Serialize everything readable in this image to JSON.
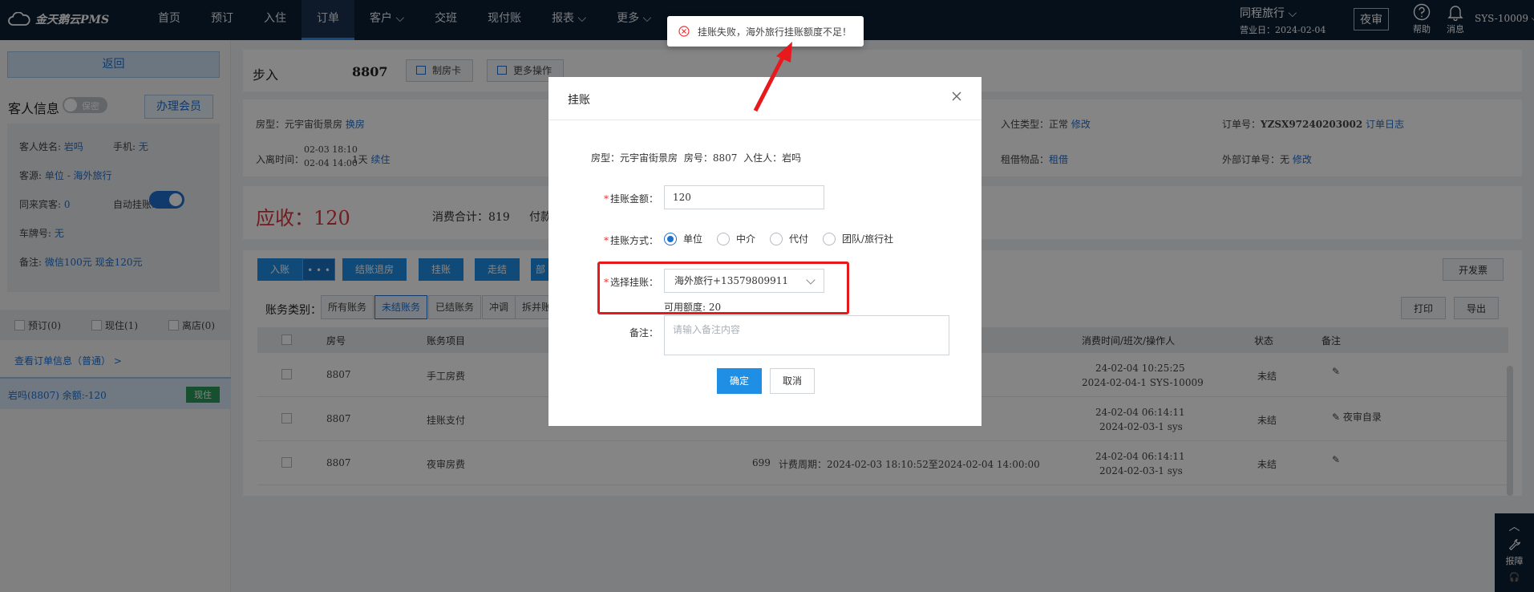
{
  "app": {
    "logo": "金天鹅云PMS"
  },
  "nav": [
    {
      "label": "首页"
    },
    {
      "label": "预订"
    },
    {
      "label": "入住"
    },
    {
      "label": "订单",
      "active": true
    },
    {
      "label": "客户 ⌵"
    },
    {
      "label": "交班"
    },
    {
      "label": "现付账"
    },
    {
      "label": "报表 ⌵"
    },
    {
      "label": "更多 ⌵"
    }
  ],
  "topright": {
    "hotel": "同程旅行 ⌵",
    "business_day": "营业日：2024-02-04",
    "night_audit": "夜审",
    "help": "帮助",
    "messages": "消息",
    "user": "SYS-10009 ⌵"
  },
  "left": {
    "back": "返回",
    "guest_title": "客人信息",
    "secret_toggle": "保密",
    "member_btn": "办理会员",
    "name_label": "客人姓名:",
    "name_value": "岩吗",
    "phone_label": "手机:",
    "phone_value": "无",
    "source_label": "客源:",
    "source_value": "单位 - 海外旅行",
    "companions_label": "同来宾客:",
    "companions_value": "0",
    "auto_bill_label": "自动挂账:",
    "plate_label": "车牌号:",
    "plate_value": "无",
    "remark_label": "备注:",
    "remark_value": "微信100元 现金120元",
    "status": [
      {
        "label": "预订(0)"
      },
      {
        "label": "现住(1)"
      },
      {
        "label": "离店(0)"
      }
    ],
    "order_link": "查看订单信息（普通） >",
    "guest_row": "岩吗(8807)   余额:-120",
    "guest_badge": "现住"
  },
  "header": {
    "state": "步入",
    "room": "8807",
    "btn_card": "制房卡",
    "btn_more": "更多操作"
  },
  "info": {
    "room_type_label": "房型：",
    "room_type": "元宇宙街景房",
    "change": "换房",
    "in_out_label": "入离时间：",
    "in_time": "02-03 18:10",
    "out_time": "02-04 14:00",
    "nights": "1天",
    "extend": "续住",
    "checkin_type_label": "入住类型：",
    "checkin_type": "正常",
    "checkin_modify": "修改",
    "borrow_label": "租借物品：",
    "borrow": "租借",
    "order_no_label": "订单号：",
    "order_no": "YZSX97240203002",
    "order_log": "订单日志",
    "ext_order_label": "外部订单号：",
    "ext_order": "无",
    "ext_modify": "修改"
  },
  "money": {
    "due": "应收：120",
    "consume": "消费合计：819",
    "paid": "付款"
  },
  "bill": {
    "btn_in": "入账",
    "btn_dots": "• • •",
    "btn_checkout_refund": "结账退房",
    "btn_hang": "挂账",
    "btn_walk": "走结",
    "btn_part": "部",
    "btn_invoice": "开发票",
    "btn_print": "打印",
    "btn_export": "导出",
    "cat_label": "账务类别：",
    "cats": [
      {
        "label": "所有账务"
      },
      {
        "label": "未结账务",
        "active": true
      },
      {
        "label": "已结账务"
      },
      {
        "label": "冲调"
      },
      {
        "label": "拆并账"
      }
    ],
    "columns": {
      "room": "房号",
      "item": "账务项目",
      "time": "消费时间/班次/操作人",
      "status": "状态",
      "remark": "备注"
    },
    "rows": [
      {
        "room": "8807",
        "item": "手工房费",
        "amount": "",
        "desc": "",
        "time1": "24-02-04 10:25:25",
        "time2": "2024-02-04-1 SYS-10009",
        "status": "未结",
        "remark": "✎"
      },
      {
        "room": "8807",
        "item": "挂账支付",
        "amount": "",
        "desc": "",
        "time1": "24-02-04 06:14:11",
        "time2": "2024-02-03-1 sys",
        "status": "未结",
        "remark": "✎ 夜审自录"
      },
      {
        "room": "8807",
        "item": "夜审房费",
        "amount": "699",
        "desc": "计费周期：2024-02-03 18:10:52至2024-02-04 14:00:00",
        "time1": "24-02-04 06:14:11",
        "time2": "2024-02-03-1 sys",
        "status": "未结",
        "remark": "✎"
      }
    ]
  },
  "side_widget": {
    "report": "报障"
  },
  "modal": {
    "title": "挂账",
    "room_info": "房型：元宇宙街景房   房号：8807   入住人：岩吗",
    "amount_label": "挂账金额：",
    "amount_value": "120",
    "method_label": "挂账方式：",
    "methods": [
      {
        "label": "单位",
        "checked": true
      },
      {
        "label": "中介"
      },
      {
        "label": "代付"
      },
      {
        "label": "团队/旅行社"
      }
    ],
    "select_label": "选择挂账：",
    "select_value": "海外旅行+13579809911",
    "available": "可用额度: 20",
    "remark_label": "备注：",
    "remark_placeholder": "请输入备注内容",
    "ok": "确定",
    "cancel": "取消"
  },
  "toast": {
    "message": "挂账失败，海外旅行挂账额度不足！"
  },
  "colors": {
    "nav_bg": "#0d1f35",
    "primary": "#1f8fe6",
    "danger": "#d9363e",
    "highlight": "#e8191c"
  }
}
